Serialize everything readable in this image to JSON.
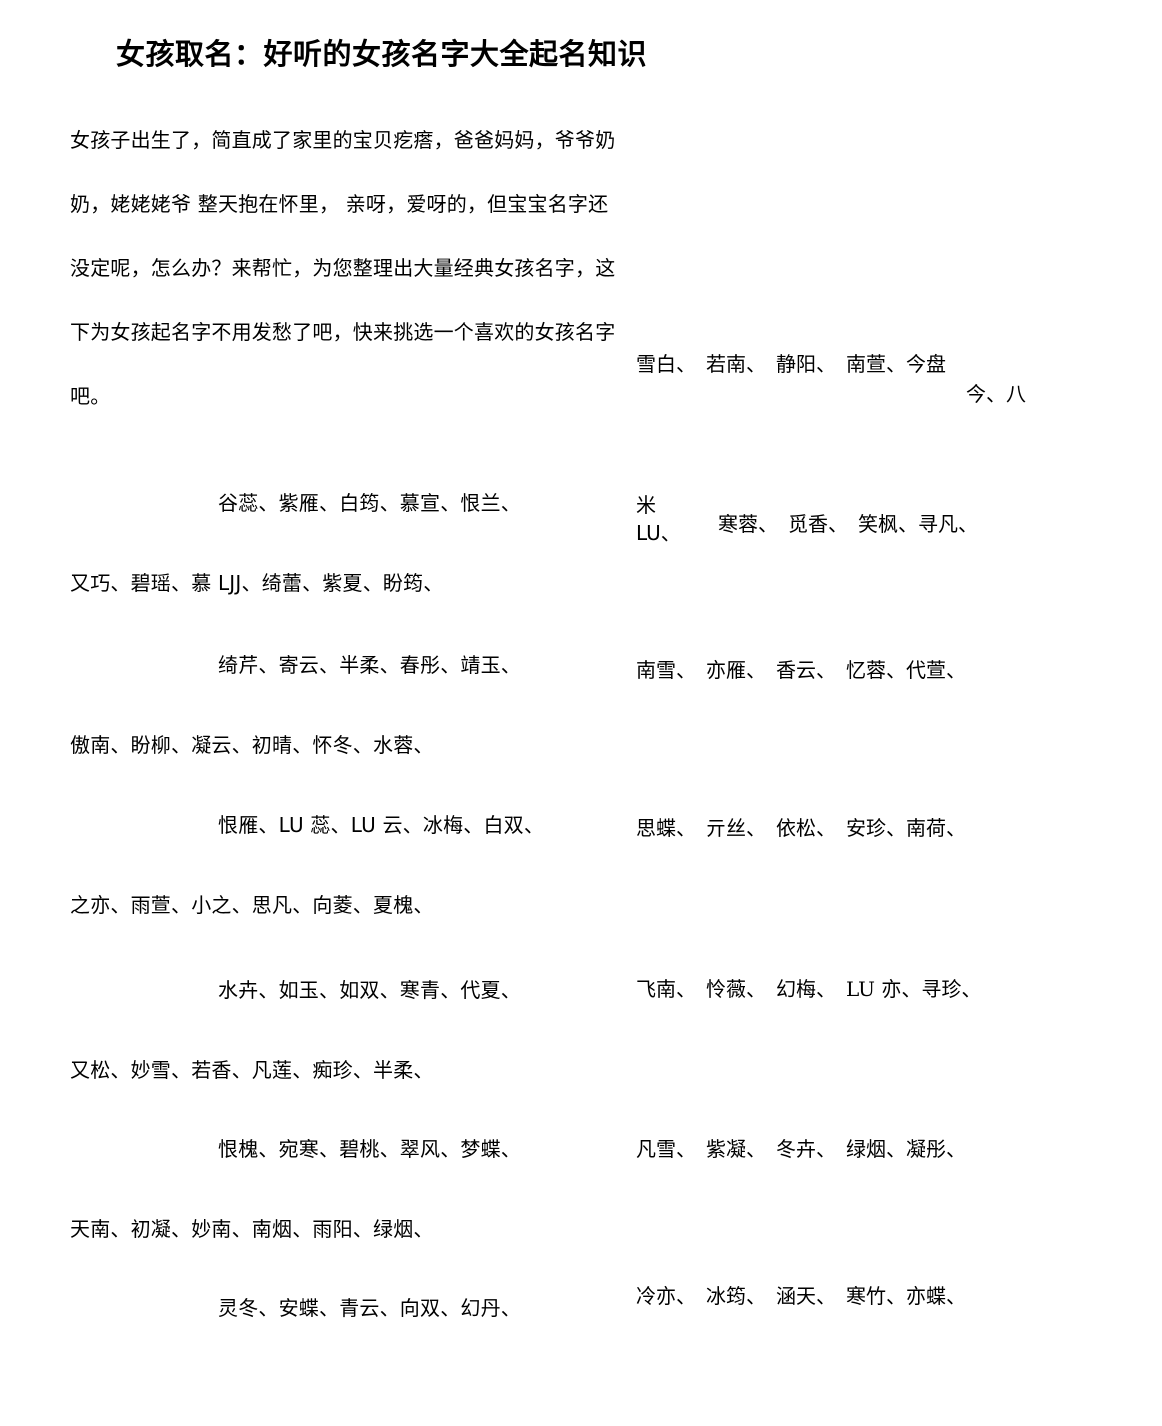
{
  "document": {
    "title": "女孩取名：好听的女孩名字大全起名知识",
    "intro": [
      "女孩子出生了，简直成了家里的宝贝疙瘩，爸爸妈妈，爷爷奶",
      "奶，姥姥姥爷 整天抱在怀里， 亲呀，爱呀的，但宝宝名字还",
      "没定呢，怎么办？来帮忙，为您整理出大量经典女孩名字，这",
      "下为女孩起名字不用发愁了吧，快来挑选一个喜欢的女孩名字",
      "吧。"
    ],
    "right_column": {
      "row1_line1": "雪白、　若南、　静阳、　南萱、今盘",
      "row1_line2": "今、八",
      "row2_stack_top": "米",
      "row2_stack_bottom": "LU、",
      "row2_rest": "寒蓉、　觅香、　笑枫、寻凡、",
      "row3": "南雪、　亦雁、　香云、　忆蓉、代萱、",
      "row4": "思蝶、　亓丝、　依松、　安珍、南荷、",
      "row5": "飞南、　怜薇、　幻梅、　LU 亦、寻珍、",
      "row6": "凡雪、　紫凝、　冬卉、　绿烟、凝彤、",
      "row7": "冷亦、　冰筠、　涵天、　寒竹、亦蝶、"
    },
    "left_column": {
      "row2_line1": "谷蕊、紫雁、白筠、慕宣、恨兰、",
      "row2_line2": "又巧、碧瑶、慕 LJJ、绮蕾、紫夏、盼筠、",
      "row3_line1": "绮芹、寄云、半柔、春彤、靖玉、",
      "row3_line2": "傲南、盼柳、凝云、初晴、怀冬、水蓉、",
      "row4_line1": "恨雁、LU 蕊、LU 云、冰梅、白双、",
      "row4_line2": "之亦、雨萱、小之、思凡、向菱、夏槐、",
      "row5_line1": "水卉、如玉、如双、寒青、代夏、",
      "row5_line2": "又松、妙雪、若香、凡莲、痴珍、半柔、",
      "row6_line1": "恨槐、宛寒、碧桃、翠风、梦蝶、",
      "row6_line2": "天南、初凝、妙南、南烟、雨阳、绿烟、",
      "row7_line1": "灵冬、安蝶、青云、向双、幻丹、"
    }
  }
}
